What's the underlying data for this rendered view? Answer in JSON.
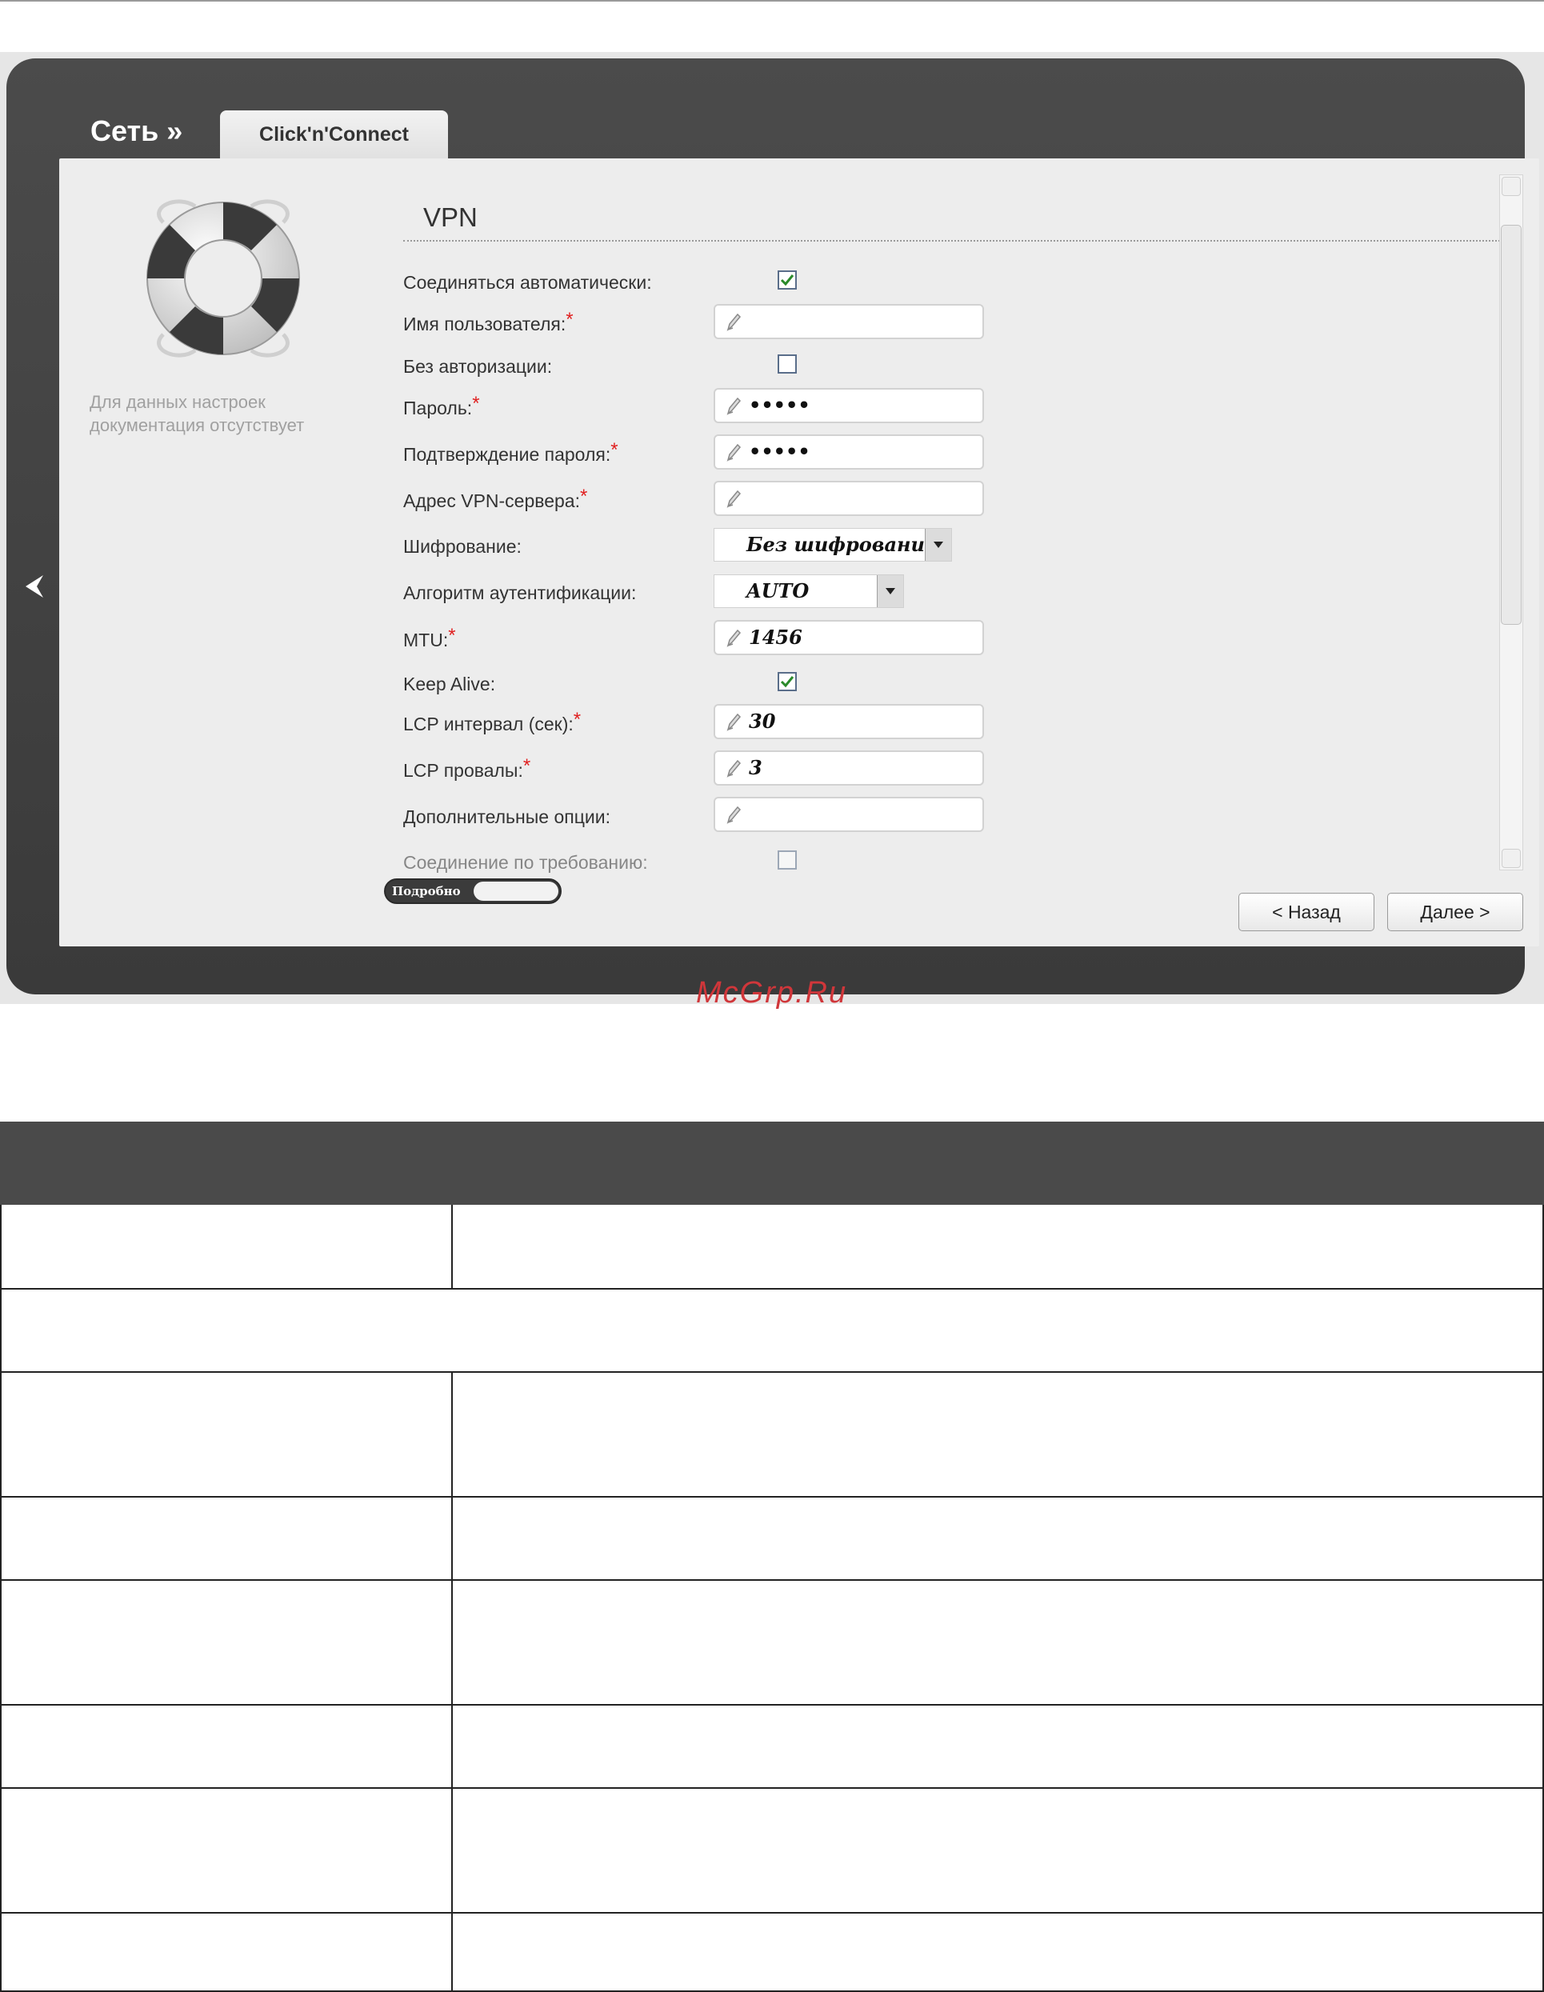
{
  "watermark": "McGrp.Ru",
  "header": {
    "section": "Сеть »",
    "tab": "Click'n'Connect"
  },
  "sidebar": {
    "note_line1": "Для данных настроек",
    "note_line2": "документация отсутствует"
  },
  "form": {
    "title": "VPN",
    "fields": {
      "auto_connect": {
        "label": "Соединяться автоматически:",
        "checked": true
      },
      "username": {
        "label": "Имя пользователя:",
        "value": ""
      },
      "no_auth": {
        "label": "Без авторизации:",
        "checked": false
      },
      "password": {
        "label": "Пароль:",
        "value": "•••••"
      },
      "password_confirm": {
        "label": "Подтверждение пароля:",
        "value": "•••••"
      },
      "vpn_server": {
        "label": "Адрес VPN-сервера:",
        "value": ""
      },
      "encryption": {
        "label": "Шифрование:",
        "value": "Без шифрования"
      },
      "auth_algorithm": {
        "label": "Алгоритм аутентификации:",
        "value": "AUTO"
      },
      "mtu": {
        "label": "MTU:",
        "value": "1456"
      },
      "keep_alive": {
        "label": "Keep Alive:",
        "checked": true
      },
      "lcp_interval": {
        "label": "LCP интервал (сек):",
        "value": "30"
      },
      "lcp_failures": {
        "label": "LCP провалы:",
        "value": "3"
      },
      "extra_options": {
        "label": "Дополнительные опции:",
        "value": ""
      },
      "on_demand": {
        "label": "Соединение по требованию:",
        "checked": false
      }
    },
    "required_mark": "*"
  },
  "footer": {
    "details_toggle": "Подробно",
    "back_button": "< Назад",
    "next_button": "Далее >"
  },
  "colors": {
    "frame": "#3f3f3f",
    "panel": "#ededed",
    "required": "#e02020",
    "watermark": "#d0363a",
    "table_header": "#4a4a4a"
  }
}
